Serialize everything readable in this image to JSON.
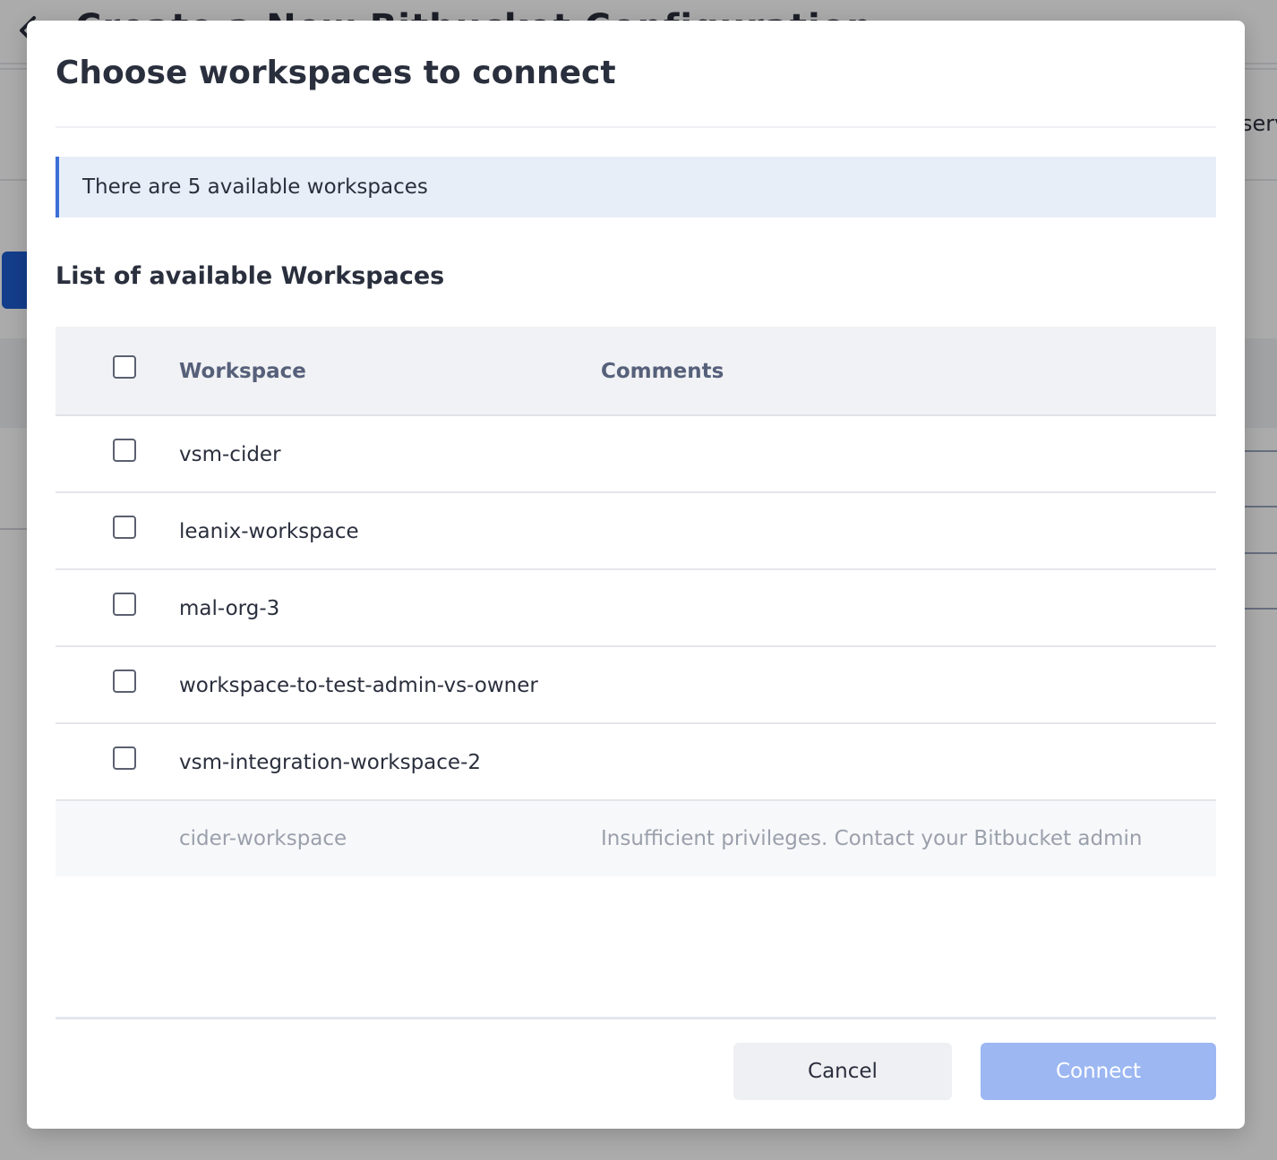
{
  "background": {
    "page_title": "Create a New Bitbucket Configuration",
    "card_text": "serv"
  },
  "modal": {
    "title": "Choose workspaces to connect",
    "info_banner": "There are 5 available workspaces",
    "list_heading": "List of available Workspaces",
    "table": {
      "columns": [
        "Workspace",
        "Comments"
      ],
      "rows": [
        {
          "workspace": "vsm-cider",
          "comment": "",
          "selectable": true,
          "checked": false
        },
        {
          "workspace": "leanix-workspace",
          "comment": "",
          "selectable": true,
          "checked": false
        },
        {
          "workspace": "mal-org-3",
          "comment": "",
          "selectable": true,
          "checked": false
        },
        {
          "workspace": "workspace-to-test-admin-vs-owner",
          "comment": "",
          "selectable": true,
          "checked": false
        },
        {
          "workspace": "vsm-integration-workspace-2",
          "comment": "",
          "selectable": true,
          "checked": false
        },
        {
          "workspace": "cider-workspace",
          "comment": "Insufficient privileges. Contact your Bitbucket admin",
          "selectable": false,
          "checked": false
        }
      ]
    },
    "buttons": {
      "cancel": "Cancel",
      "connect": "Connect"
    }
  },
  "colors": {
    "accent": "#3a6fd6",
    "connect_disabled": "#9cb7f2",
    "banner_bg": "#e8eef8"
  }
}
